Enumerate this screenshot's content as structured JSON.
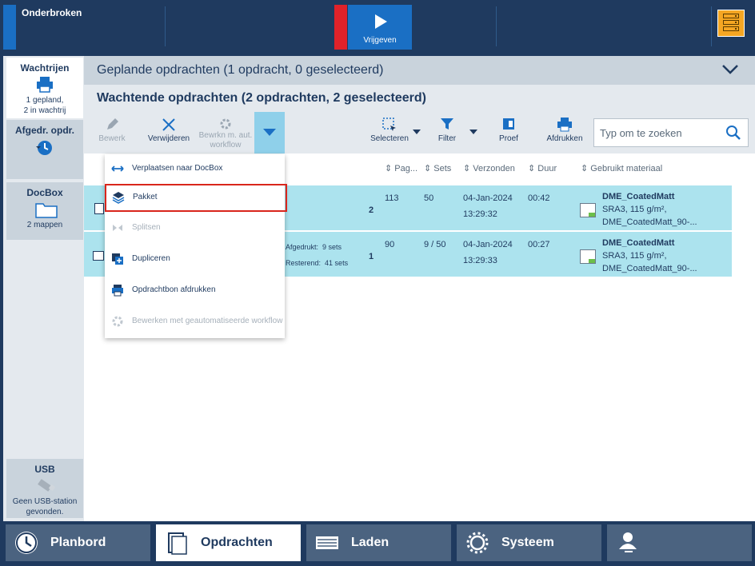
{
  "topbar": {
    "status": "Onderbroken",
    "release_label": "Vrijgeven"
  },
  "leftnav": {
    "items": [
      {
        "title": "Wachtrijen",
        "sub1": "1 gepland,",
        "sub2": "2 in wachtrij",
        "icon": "printer-icon",
        "active": true
      },
      {
        "title": "Afgedr. opdr.",
        "icon": "history-icon"
      },
      {
        "title": "DocBox",
        "sub1": "2 mappen",
        "icon": "folder-icon"
      },
      {
        "title": "USB",
        "sub1": "Geen USB-station",
        "sub2": "gevonden.",
        "icon": "usb-icon"
      }
    ]
  },
  "main": {
    "planned_header": "Geplande opdrachten (1 opdracht, 0 geselecteerd)",
    "waiting_header": "Wachtende opdrachten (2 opdrachten, 2 geselecteerd)",
    "toolbar": {
      "edit": "Bewerk",
      "delete": "Verwijderen",
      "auto_wf_1": "Bewrkn m. aut.",
      "auto_wf_2": "workflow",
      "select": "Selecteren",
      "filter": "Filter",
      "proof": "Proef",
      "print": "Afdrukken",
      "search_placeholder": "Typ om te zoeken"
    },
    "columns": {
      "pages": "Pag...",
      "sets": "Sets",
      "sent": "Verzonden",
      "duration": "Duur",
      "material": "Gebruikt materiaal"
    },
    "rows": [
      {
        "count": "2",
        "pages": "113",
        "sets": "50",
        "date": "04-Jan-2024",
        "time": "13:29:32",
        "duration": "00:42",
        "mat1": "DME_CoatedMatt",
        "mat2": "SRA3, 115 g/m²,",
        "mat3": "DME_CoatedMatt_90-..."
      },
      {
        "count": "1",
        "printed_label": "Afgedrukt:",
        "printed": "9 sets",
        "remaining_label": "Resterend:",
        "remaining": "41 sets",
        "pages": "90",
        "sets": "9 / 50",
        "date": "04-Jan-2024",
        "time": "13:29:33",
        "duration": "00:27",
        "mat1": "DME_CoatedMatt",
        "mat2": "SRA3, 115 g/m²,",
        "mat3": "DME_CoatedMatt_90-..."
      }
    ]
  },
  "menu": {
    "items": [
      {
        "label": "Verplaatsen naar DocBox",
        "icon": "move-arrows-icon",
        "enabled": true
      },
      {
        "label": "Pakket",
        "icon": "stack-icon",
        "enabled": true,
        "highlighted": true
      },
      {
        "label": "Splitsen",
        "icon": "split-icon",
        "enabled": false
      },
      {
        "label": "Dupliceren",
        "icon": "duplicate-icon",
        "enabled": true
      },
      {
        "label": "Opdrachtbon afdrukken",
        "icon": "ticket-print-icon",
        "enabled": true
      },
      {
        "label": "Bewerken met geautomatiseerde workflow",
        "icon": "auto-workflow-icon",
        "enabled": false
      }
    ]
  },
  "bottombar": {
    "planbord": "Planbord",
    "jobs": "Opdrachten",
    "load": "Laden",
    "system": "Systeem"
  },
  "colors": {
    "navy": "#1f3a5f",
    "accent_blue": "#1a6fc4",
    "row_selected": "#ace3ee",
    "alert_red": "#e0222a",
    "warning_orange": "#f5a623"
  }
}
